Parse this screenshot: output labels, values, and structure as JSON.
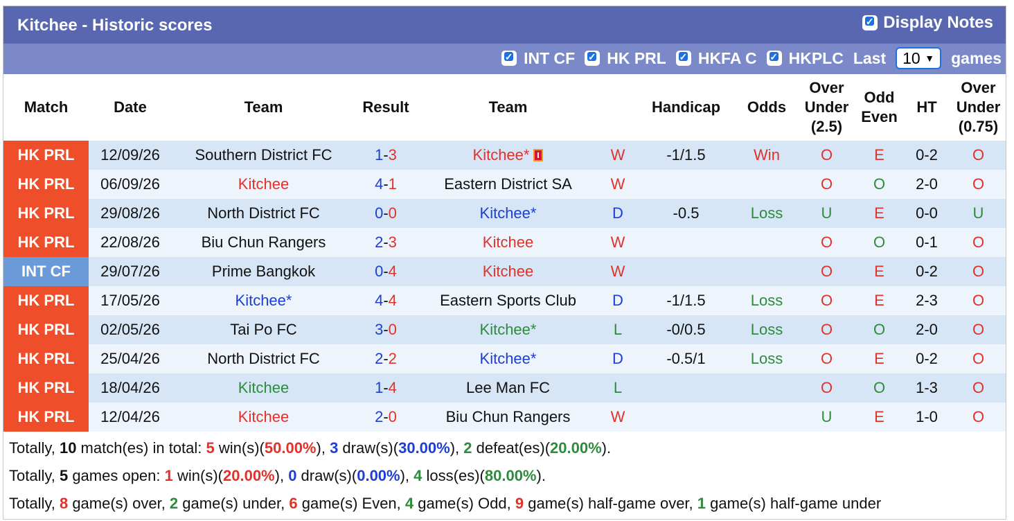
{
  "header": {
    "title": "Kitchee - Historic scores",
    "display_notes_label": "Display Notes",
    "filters": [
      {
        "label": "INT CF",
        "checked": true
      },
      {
        "label": "HK PRL",
        "checked": true
      },
      {
        "label": "HKFA C",
        "checked": true
      },
      {
        "label": "HKPLC",
        "checked": true
      }
    ],
    "last_label": "Last",
    "games_count": "10",
    "games_label": "games"
  },
  "table": {
    "columns": {
      "match": "Match",
      "date": "Date",
      "team1": "Team",
      "result": "Result",
      "team2": "Team",
      "handicap": "Handicap",
      "odds": "Odds",
      "ou_1": "Over",
      "ou_2": "Under",
      "ou_3": "(2.5)",
      "oe_1": "Odd",
      "oe_2": "Even",
      "ht": "HT",
      "ou2_1": "Over",
      "ou2_2": "Under",
      "ou2_3": "(0.75)"
    },
    "rows": [
      {
        "league": "HK PRL",
        "league_color": "#ee4e2a",
        "date": "12/09/26",
        "home": "Southern District FC",
        "home_color": "#111111",
        "hs": "1",
        "as": "3",
        "away": "Kitchee*",
        "away_color": "#e0322a",
        "red_card": true,
        "wld": "W",
        "wld_color": "#e0322a",
        "handicap": "-1/1.5",
        "odds": "Win",
        "odds_color": "#e0322a",
        "ou": "O",
        "ou_color": "#e0322a",
        "oe": "E",
        "oe_color": "#e0322a",
        "ht": "0-2",
        "ou2": "O",
        "ou2_color": "#e0322a"
      },
      {
        "league": "HK PRL",
        "league_color": "#ee4e2a",
        "date": "06/09/26",
        "home": "Kitchee",
        "home_color": "#e0322a",
        "hs": "4",
        "as": "1",
        "away": "Eastern District SA",
        "away_color": "#111111",
        "red_card": false,
        "wld": "W",
        "wld_color": "#e0322a",
        "handicap": "",
        "odds": "",
        "odds_color": "#111111",
        "ou": "O",
        "ou_color": "#e0322a",
        "oe": "O",
        "oe_color": "#2e8b3d",
        "ht": "2-0",
        "ou2": "O",
        "ou2_color": "#e0322a"
      },
      {
        "league": "HK PRL",
        "league_color": "#ee4e2a",
        "date": "29/08/26",
        "home": "North District FC",
        "home_color": "#111111",
        "hs": "0",
        "as": "0",
        "away": "Kitchee*",
        "away_color": "#1c3ed2",
        "red_card": false,
        "wld": "D",
        "wld_color": "#1c3ed2",
        "handicap": "-0.5",
        "odds": "Loss",
        "odds_color": "#2e8b3d",
        "ou": "U",
        "ou_color": "#2e8b3d",
        "oe": "E",
        "oe_color": "#e0322a",
        "ht": "0-0",
        "ou2": "U",
        "ou2_color": "#2e8b3d"
      },
      {
        "league": "HK PRL",
        "league_color": "#ee4e2a",
        "date": "22/08/26",
        "home": "Biu Chun Rangers",
        "home_color": "#111111",
        "hs": "2",
        "as": "3",
        "away": "Kitchee",
        "away_color": "#e0322a",
        "red_card": false,
        "wld": "W",
        "wld_color": "#e0322a",
        "handicap": "",
        "odds": "",
        "odds_color": "#111111",
        "ou": "O",
        "ou_color": "#e0322a",
        "oe": "O",
        "oe_color": "#2e8b3d",
        "ht": "0-1",
        "ou2": "O",
        "ou2_color": "#e0322a"
      },
      {
        "league": "INT CF",
        "league_color": "#6a9bd8",
        "date": "29/07/26",
        "home": "Prime Bangkok",
        "home_color": "#111111",
        "hs": "0",
        "as": "4",
        "away": "Kitchee",
        "away_color": "#e0322a",
        "red_card": false,
        "wld": "W",
        "wld_color": "#e0322a",
        "handicap": "",
        "odds": "",
        "odds_color": "#111111",
        "ou": "O",
        "ou_color": "#e0322a",
        "oe": "E",
        "oe_color": "#e0322a",
        "ht": "0-2",
        "ou2": "O",
        "ou2_color": "#e0322a"
      },
      {
        "league": "HK PRL",
        "league_color": "#ee4e2a",
        "date": "17/05/26",
        "home": "Kitchee*",
        "home_color": "#1c3ed2",
        "hs": "4",
        "as": "4",
        "away": "Eastern Sports Club",
        "away_color": "#111111",
        "red_card": false,
        "wld": "D",
        "wld_color": "#1c3ed2",
        "handicap": "-1/1.5",
        "odds": "Loss",
        "odds_color": "#2e8b3d",
        "ou": "O",
        "ou_color": "#e0322a",
        "oe": "E",
        "oe_color": "#e0322a",
        "ht": "2-3",
        "ou2": "O",
        "ou2_color": "#e0322a"
      },
      {
        "league": "HK PRL",
        "league_color": "#ee4e2a",
        "date": "02/05/26",
        "home": "Tai Po FC",
        "home_color": "#111111",
        "hs": "3",
        "as": "0",
        "away": "Kitchee*",
        "away_color": "#2e8b3d",
        "red_card": false,
        "wld": "L",
        "wld_color": "#2e8b3d",
        "handicap": "-0/0.5",
        "odds": "Loss",
        "odds_color": "#2e8b3d",
        "ou": "O",
        "ou_color": "#e0322a",
        "oe": "O",
        "oe_color": "#2e8b3d",
        "ht": "2-0",
        "ou2": "O",
        "ou2_color": "#e0322a"
      },
      {
        "league": "HK PRL",
        "league_color": "#ee4e2a",
        "date": "25/04/26",
        "home": "North District FC",
        "home_color": "#111111",
        "hs": "2",
        "as": "2",
        "away": "Kitchee*",
        "away_color": "#1c3ed2",
        "red_card": false,
        "wld": "D",
        "wld_color": "#1c3ed2",
        "handicap": "-0.5/1",
        "odds": "Loss",
        "odds_color": "#2e8b3d",
        "ou": "O",
        "ou_color": "#e0322a",
        "oe": "E",
        "oe_color": "#e0322a",
        "ht": "0-2",
        "ou2": "O",
        "ou2_color": "#e0322a"
      },
      {
        "league": "HK PRL",
        "league_color": "#ee4e2a",
        "date": "18/04/26",
        "home": "Kitchee",
        "home_color": "#2e8b3d",
        "hs": "1",
        "as": "4",
        "away": "Lee Man FC",
        "away_color": "#111111",
        "red_card": false,
        "wld": "L",
        "wld_color": "#2e8b3d",
        "handicap": "",
        "odds": "",
        "odds_color": "#111111",
        "ou": "O",
        "ou_color": "#e0322a",
        "oe": "O",
        "oe_color": "#2e8b3d",
        "ht": "1-3",
        "ou2": "O",
        "ou2_color": "#e0322a"
      },
      {
        "league": "HK PRL",
        "league_color": "#ee4e2a",
        "date": "12/04/26",
        "home": "Kitchee",
        "home_color": "#e0322a",
        "hs": "2",
        "as": "0",
        "away": "Biu Chun Rangers",
        "away_color": "#111111",
        "red_card": false,
        "wld": "W",
        "wld_color": "#e0322a",
        "handicap": "",
        "odds": "",
        "odds_color": "#111111",
        "ou": "U",
        "ou_color": "#2e8b3d",
        "oe": "E",
        "oe_color": "#e0322a",
        "ht": "1-0",
        "ou2": "O",
        "ou2_color": "#e0322a"
      }
    ]
  },
  "summary": {
    "line1": {
      "p1": "Totally, ",
      "matches": "10",
      "p2": " match(es) in total: ",
      "wins": "5",
      "p3": " win(s)(",
      "win_pct": "50.00%",
      "p4": "), ",
      "draws": "3",
      "p5": " draw(s)(",
      "draw_pct": "30.00%",
      "p6": "), ",
      "defeats": "2",
      "p7": " defeat(es)(",
      "defeat_pct": "20.00%",
      "p8": ")."
    },
    "line2": {
      "p1": "Totally, ",
      "games": "5",
      "p2": " games open: ",
      "wins": "1",
      "p3": " win(s)(",
      "win_pct": "20.00%",
      "p4": "), ",
      "draws": "0",
      "p5": " draw(s)(",
      "draw_pct": "0.00%",
      "p6": "), ",
      "losses": "4",
      "p7": " loss(es)(",
      "loss_pct": "80.00%",
      "p8": ")."
    },
    "line3": {
      "p1": "Totally, ",
      "over": "8",
      "p2": " game(s) over, ",
      "under": "2",
      "p3": " game(s) under, ",
      "even": "6",
      "p4": " game(s) Even, ",
      "odd": "4",
      "p5": " game(s) Odd, ",
      "hg_over": "9",
      "p6": " game(s) half-game over, ",
      "hg_under": "1",
      "p7": " game(s) half-game under"
    }
  },
  "colors": {
    "title_bg": "#5867b0",
    "filter_bg": "#7b89c9",
    "hk_prl": "#ee4e2a",
    "int_cf": "#6a9bd8",
    "win": "#e0322a",
    "draw": "#1c3ed2",
    "loss": "#2e8b3d"
  }
}
